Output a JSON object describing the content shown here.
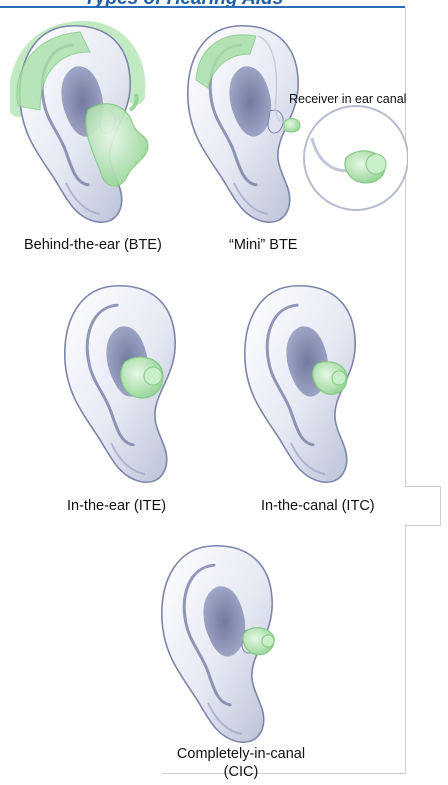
{
  "header": {
    "title": "Types of Hearing Aids"
  },
  "callout": {
    "label": "Receiver in ear canal"
  },
  "devices": [
    {
      "label": "Behind-the-ear  (BTE)"
    },
    {
      "label": "“Mini” BTE"
    },
    {
      "label": "In-the-ear (ITE)"
    },
    {
      "label": "In-the-canal  (ITC)"
    },
    {
      "line1": "Completely-in-canal",
      "line2": "(CIC)"
    }
  ],
  "colors": {
    "device": "#9ed89e",
    "title": "#1f5fa8",
    "ear_shade": "#8a93b8"
  }
}
